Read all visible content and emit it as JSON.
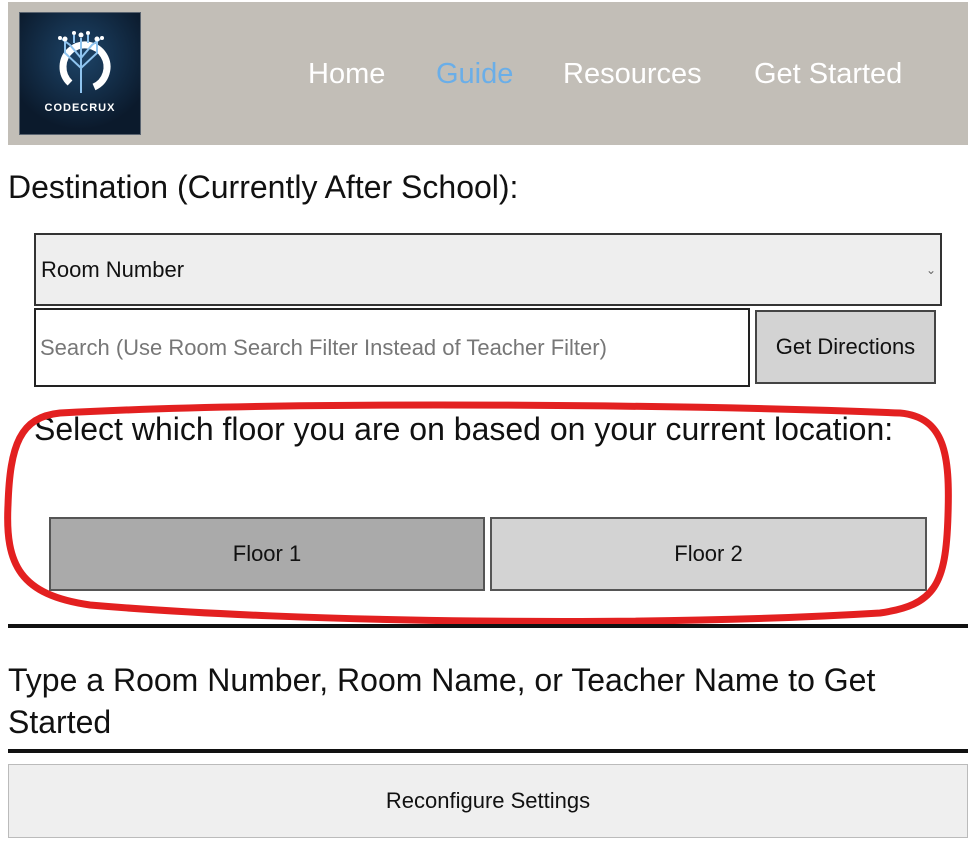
{
  "header": {
    "logo_text": "CODECRUX",
    "nav": [
      {
        "label": "Home"
      },
      {
        "label": "Guide",
        "active": true
      },
      {
        "label": "Resources"
      },
      {
        "label": "Get Started"
      }
    ],
    "active_color": "#6aaee8"
  },
  "destination": {
    "heading": "Destination (Currently After School):",
    "select_value": "Room Number",
    "search_placeholder": "Search (Use Room Search Filter Instead of Teacher Filter)",
    "get_directions": "Get Directions"
  },
  "floor": {
    "prompt": "Select which floor you are on based on your current location:",
    "buttons": [
      {
        "label": "Floor 1"
      },
      {
        "label": "Floor 2"
      }
    ]
  },
  "info": "Type a Room Number, Room Name, or Teacher Name to Get Started",
  "reconfigure": "Reconfigure Settings",
  "annotation_color": "#e32020"
}
